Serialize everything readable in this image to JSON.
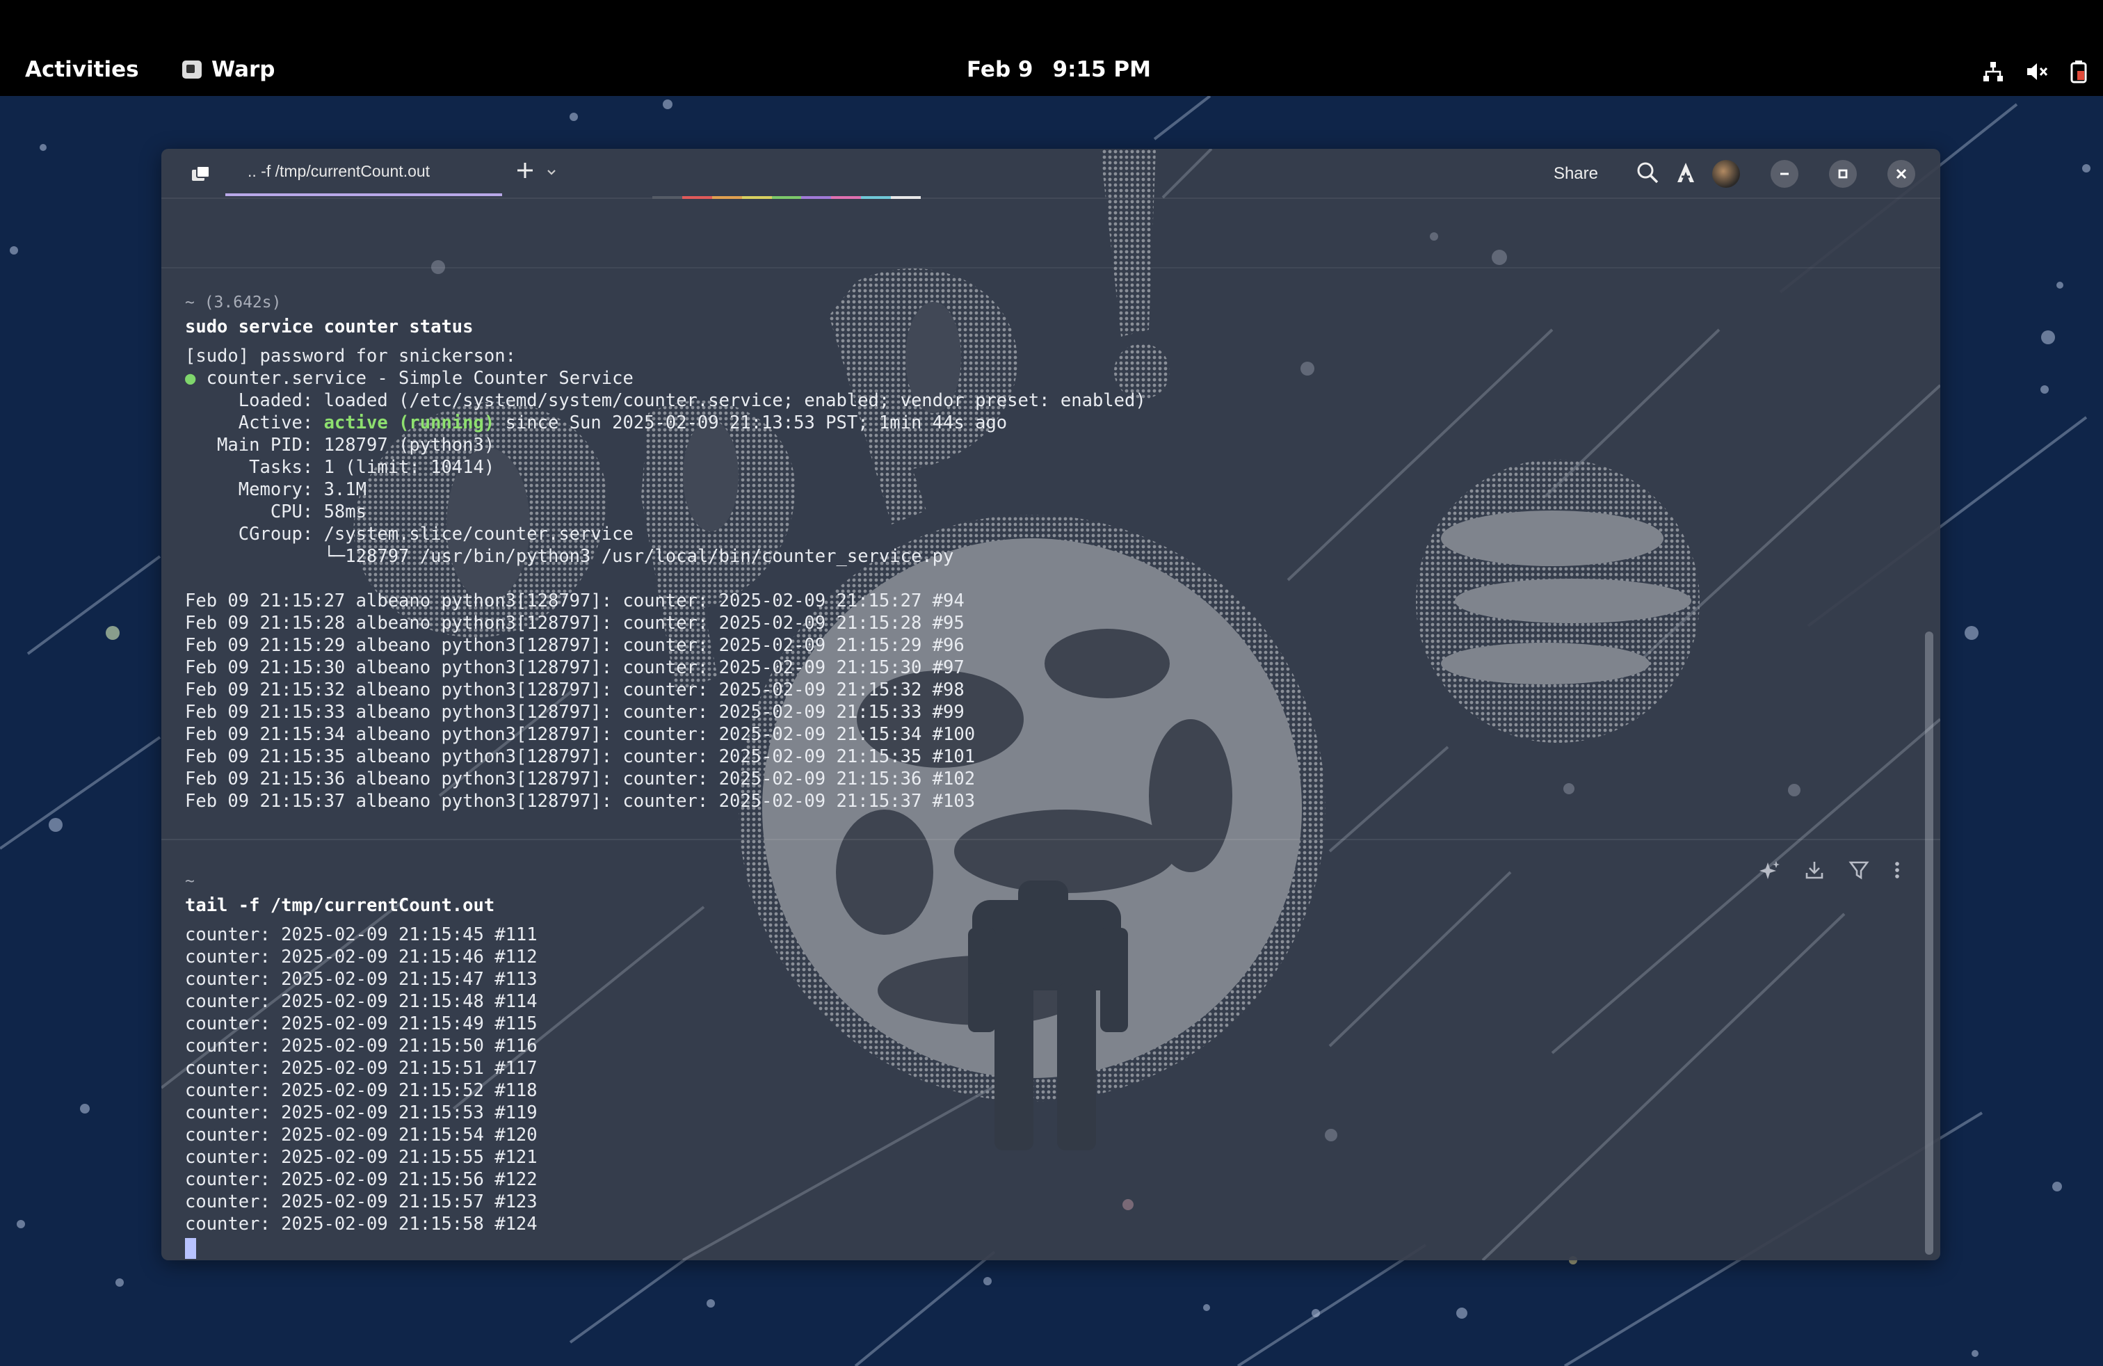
{
  "topbar": {
    "activities": "Activities",
    "app_name": "Warp",
    "date": "Feb 9",
    "time": "9:15 PM"
  },
  "window": {
    "tab_title": ".. -f /tmp/currentCount.out",
    "share_label": "Share"
  },
  "block1": {
    "meta": "~ (3.642s)",
    "command": "sudo service counter status",
    "sudo_prompt": "[sudo] password for snickerson:",
    "service_dot": "●",
    "service_line": " counter.service - Simple Counter Service",
    "loaded": "     Loaded: loaded (/etc/systemd/system/counter.service; enabled; vendor preset: enabled)",
    "active_prefix": "     Active: ",
    "active_state": "active (running)",
    "active_suffix": " since Sun 2025-02-09 21:13:53 PST; 1min 44s ago",
    "main_pid": "   Main PID: 128797 (python3)",
    "tasks": "      Tasks: 1 (limit: 10414)",
    "memory": "     Memory: 3.1M",
    "cpu": "        CPU: 58ms",
    "cgroup": "     CGroup: /system.slice/counter.service",
    "cgroup_child": "             └─128797 /usr/bin/python3 /usr/local/bin/counter_service.py",
    "log_lines": [
      "Feb 09 21:15:27 albeano python3[128797]: counter: 2025-02-09 21:15:27 #94",
      "Feb 09 21:15:28 albeano python3[128797]: counter: 2025-02-09 21:15:28 #95",
      "Feb 09 21:15:29 albeano python3[128797]: counter: 2025-02-09 21:15:29 #96",
      "Feb 09 21:15:30 albeano python3[128797]: counter: 2025-02-09 21:15:30 #97",
      "Feb 09 21:15:32 albeano python3[128797]: counter: 2025-02-09 21:15:32 #98",
      "Feb 09 21:15:33 albeano python3[128797]: counter: 2025-02-09 21:15:33 #99",
      "Feb 09 21:15:34 albeano python3[128797]: counter: 2025-02-09 21:15:34 #100",
      "Feb 09 21:15:35 albeano python3[128797]: counter: 2025-02-09 21:15:35 #101",
      "Feb 09 21:15:36 albeano python3[128797]: counter: 2025-02-09 21:15:36 #102",
      "Feb 09 21:15:37 albeano python3[128797]: counter: 2025-02-09 21:15:37 #103"
    ]
  },
  "block2": {
    "meta": "~",
    "command": "tail -f /tmp/currentCount.out",
    "output_lines": [
      "counter: 2025-02-09 21:15:45 #111",
      "counter: 2025-02-09 21:15:46 #112",
      "counter: 2025-02-09 21:15:47 #113",
      "counter: 2025-02-09 21:15:48 #114",
      "counter: 2025-02-09 21:15:49 #115",
      "counter: 2025-02-09 21:15:50 #116",
      "counter: 2025-02-09 21:15:51 #117",
      "counter: 2025-02-09 21:15:52 #118",
      "counter: 2025-02-09 21:15:53 #119",
      "counter: 2025-02-09 21:15:54 #120",
      "counter: 2025-02-09 21:15:55 #121",
      "counter: 2025-02-09 21:15:56 #122",
      "counter: 2025-02-09 21:15:57 #123",
      "counter: 2025-02-09 21:15:58 #124"
    ]
  },
  "icons": {
    "tab_icon": "warp-tab-icon",
    "new_tab": "plus-icon",
    "new_tab_menu": "chevron-down-icon",
    "search": "search-icon",
    "warp_ai": "warp-logo-icon",
    "avatar": "user-avatar",
    "minimize": "minimize-icon",
    "maximize": "maximize-icon",
    "close": "close-icon",
    "block_ai": "sparkle-icon",
    "block_download": "download-icon",
    "block_filter": "filter-icon",
    "block_more": "more-vertical-icon",
    "network": "network-icon",
    "volume": "volume-muted-icon",
    "battery": "battery-icon"
  },
  "colors": {
    "desktop_bg": "#0f2549",
    "terminal_bg": "#383f4c",
    "tab_underline": "#b9a8e8",
    "status_green": "#8ee06f",
    "cursor": "#b8c3ff"
  }
}
